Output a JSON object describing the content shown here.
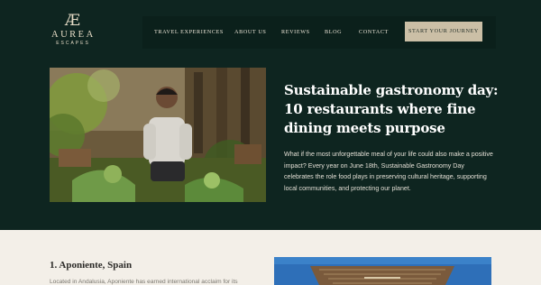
{
  "brand": {
    "mark": "Æ",
    "name": "AUREA",
    "tagline": "ESCAPES"
  },
  "nav": {
    "items": [
      "TRAVEL EXPERIENCES",
      "ABOUT US",
      "REVIEWS",
      "BLOG",
      "CONTACT"
    ],
    "cta": "START YOUR JOURNEY"
  },
  "article": {
    "title": "Sustainable gastronomy day: 10 restaurants where fine dining meets purpose",
    "intro": "What if the most unforgettable meal of your life could also make a positive impact? Every year on June 18th, Sustainable Gastronomy Day celebrates the role food plays in preserving cultural heritage, supporting local communities, and protecting our planet."
  },
  "section": {
    "heading": "1. Aponiente, Spain",
    "text": "Located in Andalusia, Aponiente has earned international acclaim for its"
  },
  "colors": {
    "hero_bg": "#0e2520",
    "nav_bg": "#0b201b",
    "cta_bg": "#cbbfa6",
    "page_bg": "#f3efe8",
    "logo": "#e6dcc6"
  }
}
